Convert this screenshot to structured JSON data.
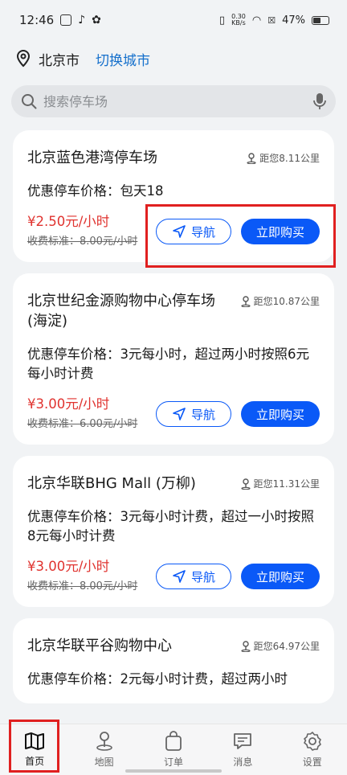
{
  "status_bar": {
    "time": "12:46",
    "net_speed_value": "0.30",
    "net_speed_unit": "KB/s",
    "battery": "47%"
  },
  "location": {
    "city": "北京市",
    "switch_label": "切换城市"
  },
  "search": {
    "placeholder": "搜索停车场"
  },
  "parking_lots": [
    {
      "name": "北京蓝色港湾停车场",
      "distance": "距您8.11公里",
      "discount": "优惠停车价格：包天18",
      "price": "¥2.50元/小时",
      "standard": "收费标准：8.00元/小时",
      "nav_label": "导航",
      "buy_label": "立即购买"
    },
    {
      "name": "北京世纪金源购物中心停车场(海淀)",
      "distance": "距您10.87公里",
      "discount": "优惠停车价格：3元每小时，超过两小时按照6元每小时计费",
      "price": "¥3.00元/小时",
      "standard": "收费标准：6.00元/小时",
      "nav_label": "导航",
      "buy_label": "立即购买"
    },
    {
      "name": "北京华联BHG Mall (万柳)",
      "distance": "距您11.31公里",
      "discount": "优惠停车价格：3元每小时计费，超过一小时按照8元每小时计费",
      "price": "¥3.00元/小时",
      "standard": "收费标准：8.00元/小时",
      "nav_label": "导航",
      "buy_label": "立即购买"
    },
    {
      "name": "北京华联平谷购物中心",
      "distance": "距您64.97公里",
      "discount": "优惠停车价格：2元每小时计费，超过两小时",
      "price": "",
      "standard": "",
      "nav_label": "",
      "buy_label": ""
    }
  ],
  "tabs": [
    {
      "label": "首页",
      "icon": "map-book-icon"
    },
    {
      "label": "地图",
      "icon": "map-pin-icon"
    },
    {
      "label": "订单",
      "icon": "bag-icon"
    },
    {
      "label": "消息",
      "icon": "message-icon"
    },
    {
      "label": "设置",
      "icon": "gear-icon"
    }
  ],
  "colors": {
    "accent": "#0a59f7",
    "price": "#e0332f",
    "highlight": "#e02020",
    "link": "#1670cc"
  }
}
